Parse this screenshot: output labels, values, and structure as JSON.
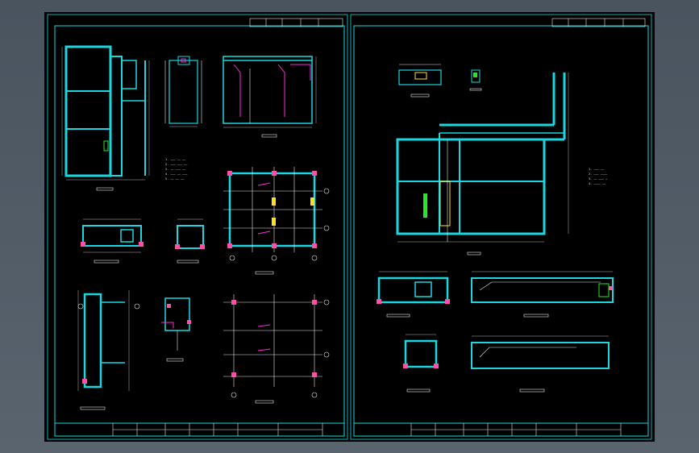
{
  "drawing": {
    "sheet_left": "left-sheet",
    "sheet_right": "right-sheet"
  },
  "colors": {
    "background": "#000000",
    "frame": "#19d7e0",
    "linework": "#e8e8e8",
    "annotation": "#ff2bd6",
    "highlight": "#29e629",
    "column": "#ff4fa8"
  }
}
